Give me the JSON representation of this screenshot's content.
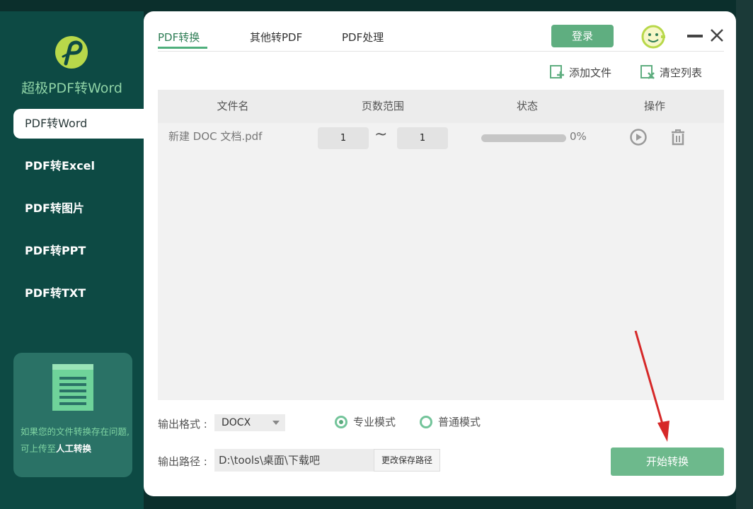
{
  "app": {
    "title": "超极PDF转Word"
  },
  "sidebar": {
    "items": [
      {
        "label": "PDF转Word"
      },
      {
        "label": "PDF转Excel"
      },
      {
        "label": "PDF转图片"
      },
      {
        "label": "PDF转PPT"
      },
      {
        "label": "PDF转TXT"
      }
    ],
    "active_index": 0,
    "help": {
      "text": "如果您的文件转换存在问题,可上传至",
      "link": "人工转换"
    }
  },
  "tabs": [
    {
      "label": "PDF转换"
    },
    {
      "label": "其他转PDF"
    },
    {
      "label": "PDF处理"
    }
  ],
  "header": {
    "login_label": "登录"
  },
  "toolbar": {
    "add_file": "添加文件",
    "clear_list": "清空列表"
  },
  "table": {
    "columns": [
      "文件名",
      "页数范围",
      "状态",
      "操作"
    ],
    "rows": [
      {
        "filename": "新建 DOC 文档.pdf",
        "page_from": "1",
        "page_to": "1",
        "separator": "~",
        "progress_text": "0%",
        "progress": 0
      }
    ]
  },
  "output": {
    "format_label": "输出格式 :",
    "format_value": "DOCX",
    "mode_pro": "专业模式",
    "mode_normal": "普通模式",
    "selected_mode": "pro",
    "path_label": "输出路径 :",
    "path_value": "D:\\tools\\桌面\\下载吧",
    "change_path": "更改保存路径",
    "start_label": "开始转换"
  },
  "colors": {
    "accent": "#5fae80",
    "sidebar": "#0d4a44",
    "annotation_arrow": "#d62828"
  }
}
